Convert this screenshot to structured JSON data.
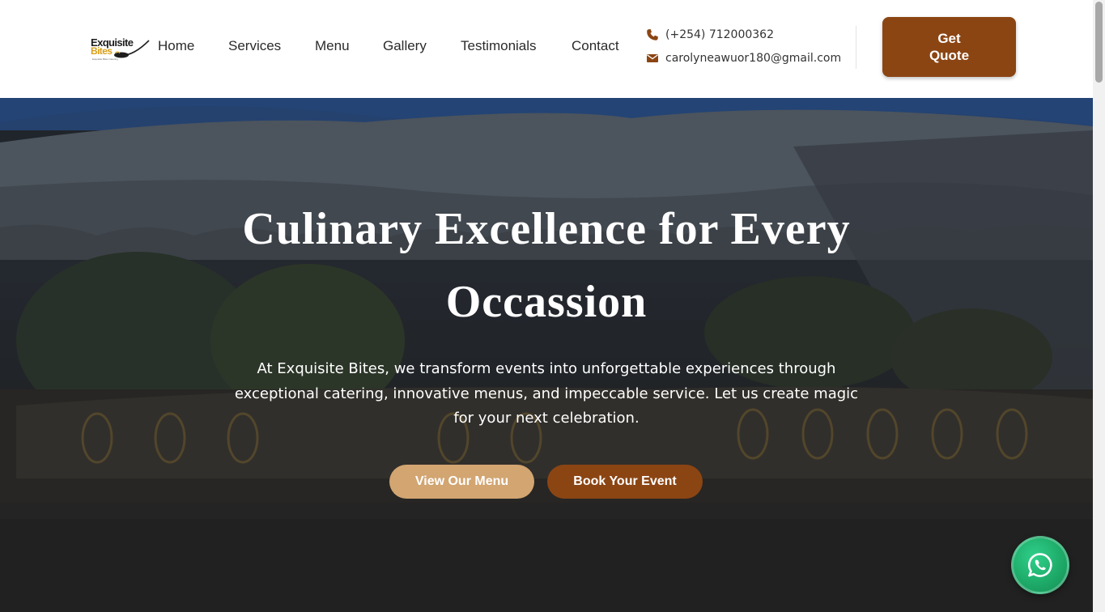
{
  "header": {
    "logo": {
      "word1": "Exquisite",
      "word2": "Bites",
      "tagline": "Exquisite Bites Catering"
    },
    "nav": [
      {
        "id": "home",
        "label": "Home"
      },
      {
        "id": "services",
        "label": "Services"
      },
      {
        "id": "menu",
        "label": "Menu"
      },
      {
        "id": "gallery",
        "label": "Gallery"
      },
      {
        "id": "testimonials",
        "label": "Testimonials"
      },
      {
        "id": "contact",
        "label": "Contact"
      }
    ],
    "phone": "(+254) 712000362",
    "email": "carolyneawuor180@gmail.com",
    "quote_button": "Get Quote"
  },
  "hero": {
    "title": "Culinary Excellence for Every Occassion",
    "subtitle": "At Exquisite Bites, we transform events into unforgettable experiences through exceptional catering, innovative menus, and impeccable service. Let us create magic for your next celebration.",
    "primary_button": "View Our Menu",
    "secondary_button": "Book Your Event"
  },
  "floating": {
    "icon": "whatsapp-icon"
  },
  "colors": {
    "brand_brown": "#8b4513",
    "accent_tan": "#d2a571",
    "whatsapp_green": "#1da867",
    "logo_gold": "#d8a01a"
  },
  "icons": {
    "phone": "phone-icon",
    "email": "envelope-icon"
  }
}
